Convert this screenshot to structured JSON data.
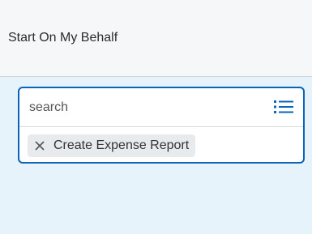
{
  "header": {
    "title": "Start On My Behalf"
  },
  "prompt": {
    "search_placeholder": "search",
    "list_icon": "list-icon",
    "selected": [
      {
        "label": "Create Expense Report",
        "remove_icon": "close-icon"
      }
    ]
  },
  "colors": {
    "accent": "#0b64b7",
    "header_bg": "#f6f7f8",
    "panel_bg": "#e7f3fb",
    "chip_bg": "#e8ebee"
  }
}
